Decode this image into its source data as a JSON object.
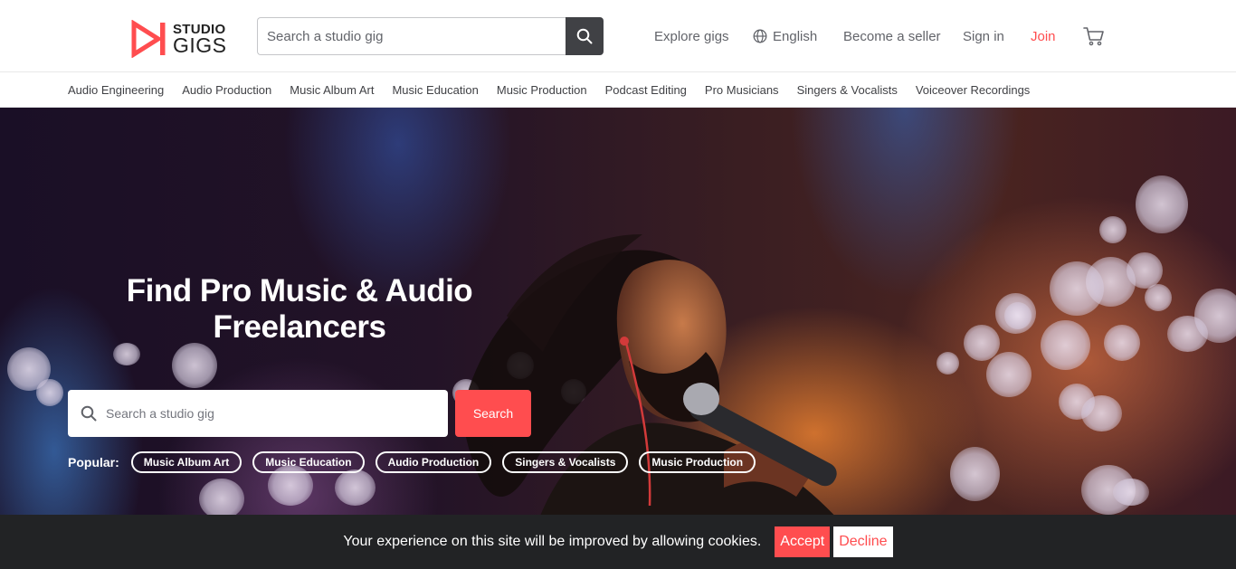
{
  "brand": {
    "line1": "STUDIO",
    "line2": "GIGS",
    "accent": "#ff4d4f"
  },
  "header": {
    "search_placeholder": "Search a studio gig",
    "nav": {
      "explore": "Explore gigs",
      "language": "English",
      "seller": "Become a seller",
      "signin": "Sign in",
      "join": "Join"
    }
  },
  "categories": [
    "Audio Engineering",
    "Audio Production",
    "Music Album Art",
    "Music Education",
    "Music Production",
    "Podcast Editing",
    "Pro Musicians",
    "Singers & Vocalists",
    "Voiceover Recordings"
  ],
  "hero": {
    "title": "Find Pro Music & Audio Freelancers",
    "search_placeholder": "Search a studio gig",
    "search_button": "Search",
    "popular_label": "Popular:",
    "popular": [
      "Music Album Art",
      "Music Education",
      "Audio Production",
      "Singers & Vocalists",
      "Music Production"
    ]
  },
  "cookie": {
    "message": "Your experience on this site will be improved by allowing cookies.",
    "accept": "Accept",
    "decline": "Decline"
  }
}
